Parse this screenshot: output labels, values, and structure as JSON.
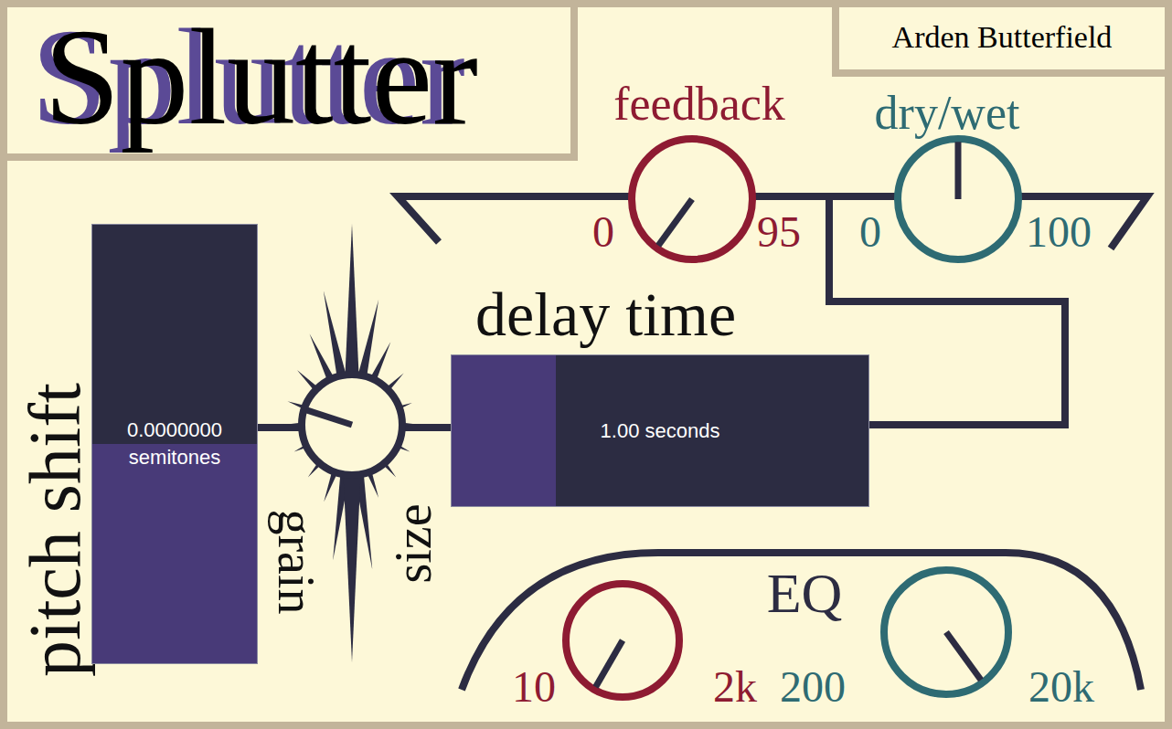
{
  "title": "Splutter",
  "author": "Arden Butterfield",
  "knobs": [
    {
      "label": "feedback",
      "min": "0",
      "max": "95",
      "level": 0.02,
      "color": "#8e1b32"
    },
    {
      "label": "dry/wet",
      "min": "0",
      "max": "100",
      "level": 0.5,
      "color": "#2e6b73"
    }
  ],
  "pitch_shift": {
    "label": "pitch shift",
    "value": "0.0000000",
    "unit": "semitones",
    "level": 0.5
  },
  "grain_size": {
    "labels": [
      "grain",
      "size"
    ],
    "level": 0.26
  },
  "delay_time": {
    "label": "delay time",
    "reading": "1.00 seconds",
    "level": 0.25
  },
  "eq": {
    "label": "EQ",
    "knobs": [
      {
        "min": "10",
        "max": "2k",
        "level": 0.0,
        "color": "#8e1b32"
      },
      {
        "min": "200",
        "max": "20k",
        "level": 0.98,
        "color": "#2e6b73"
      }
    ]
  }
}
